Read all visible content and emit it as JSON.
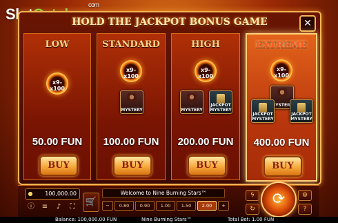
{
  "watermark": {
    "slot": "Slot",
    "catalog": "Catalog",
    "dotcom": "com"
  },
  "dialog": {
    "title": "HOLD THE JACKPOT BONUS GAME",
    "close_label": "✕",
    "options": [
      {
        "name": "LOW",
        "multipliers": [
          "x9-x100"
        ],
        "tiles": [],
        "price": "50.00 FUN",
        "buy_label": "BUY"
      },
      {
        "name": "STANDARD",
        "multipliers": [
          "x9-x100"
        ],
        "tiles": [
          [
            "MYSTERY"
          ]
        ],
        "price": "100.00 FUN",
        "buy_label": "BUY"
      },
      {
        "name": "HIGH",
        "multipliers": [
          "x9-x100"
        ],
        "tiles": [
          [
            "MYSTERY"
          ],
          [
            "JACKPOT",
            "MYSTERY"
          ]
        ],
        "price": "200.00 FUN",
        "buy_label": "BUY"
      },
      {
        "name": "EXTREME",
        "multipliers": [
          "x9-x100"
        ],
        "tiles": [
          [
            "MYSTERY"
          ],
          [
            "JACKPOT",
            "MYSTERY"
          ],
          [
            "JACKPOT",
            "MYSTERY"
          ]
        ],
        "price": "400.00 FUN",
        "buy_label": "BUY"
      }
    ]
  },
  "bottom_bar": {
    "balance_value": "100,000.00",
    "message": "Welcome to Nine Burning Stars™",
    "bet_options": [
      "0.80",
      "0.90",
      "1.00",
      "1.50",
      "2.00"
    ],
    "active_bet_index": 4,
    "left_arrow": "−",
    "right_arrow": "+",
    "icons": {
      "coin": "coin-icon",
      "info": "info-icon",
      "menu": "menu-icon",
      "sound": "sound-icon",
      "fullscreen": "fullscreen-icon",
      "cart": "cart-icon",
      "spin": "spin-icon",
      "auto": "autoplay-icon",
      "turbo": "turbo-icon"
    }
  },
  "status_bar": {
    "balance": "Balance: 100,000.00 FUN",
    "game": "Nine Burning Stars™",
    "total_bet": "Total Bet: 1.00 FUN"
  }
}
